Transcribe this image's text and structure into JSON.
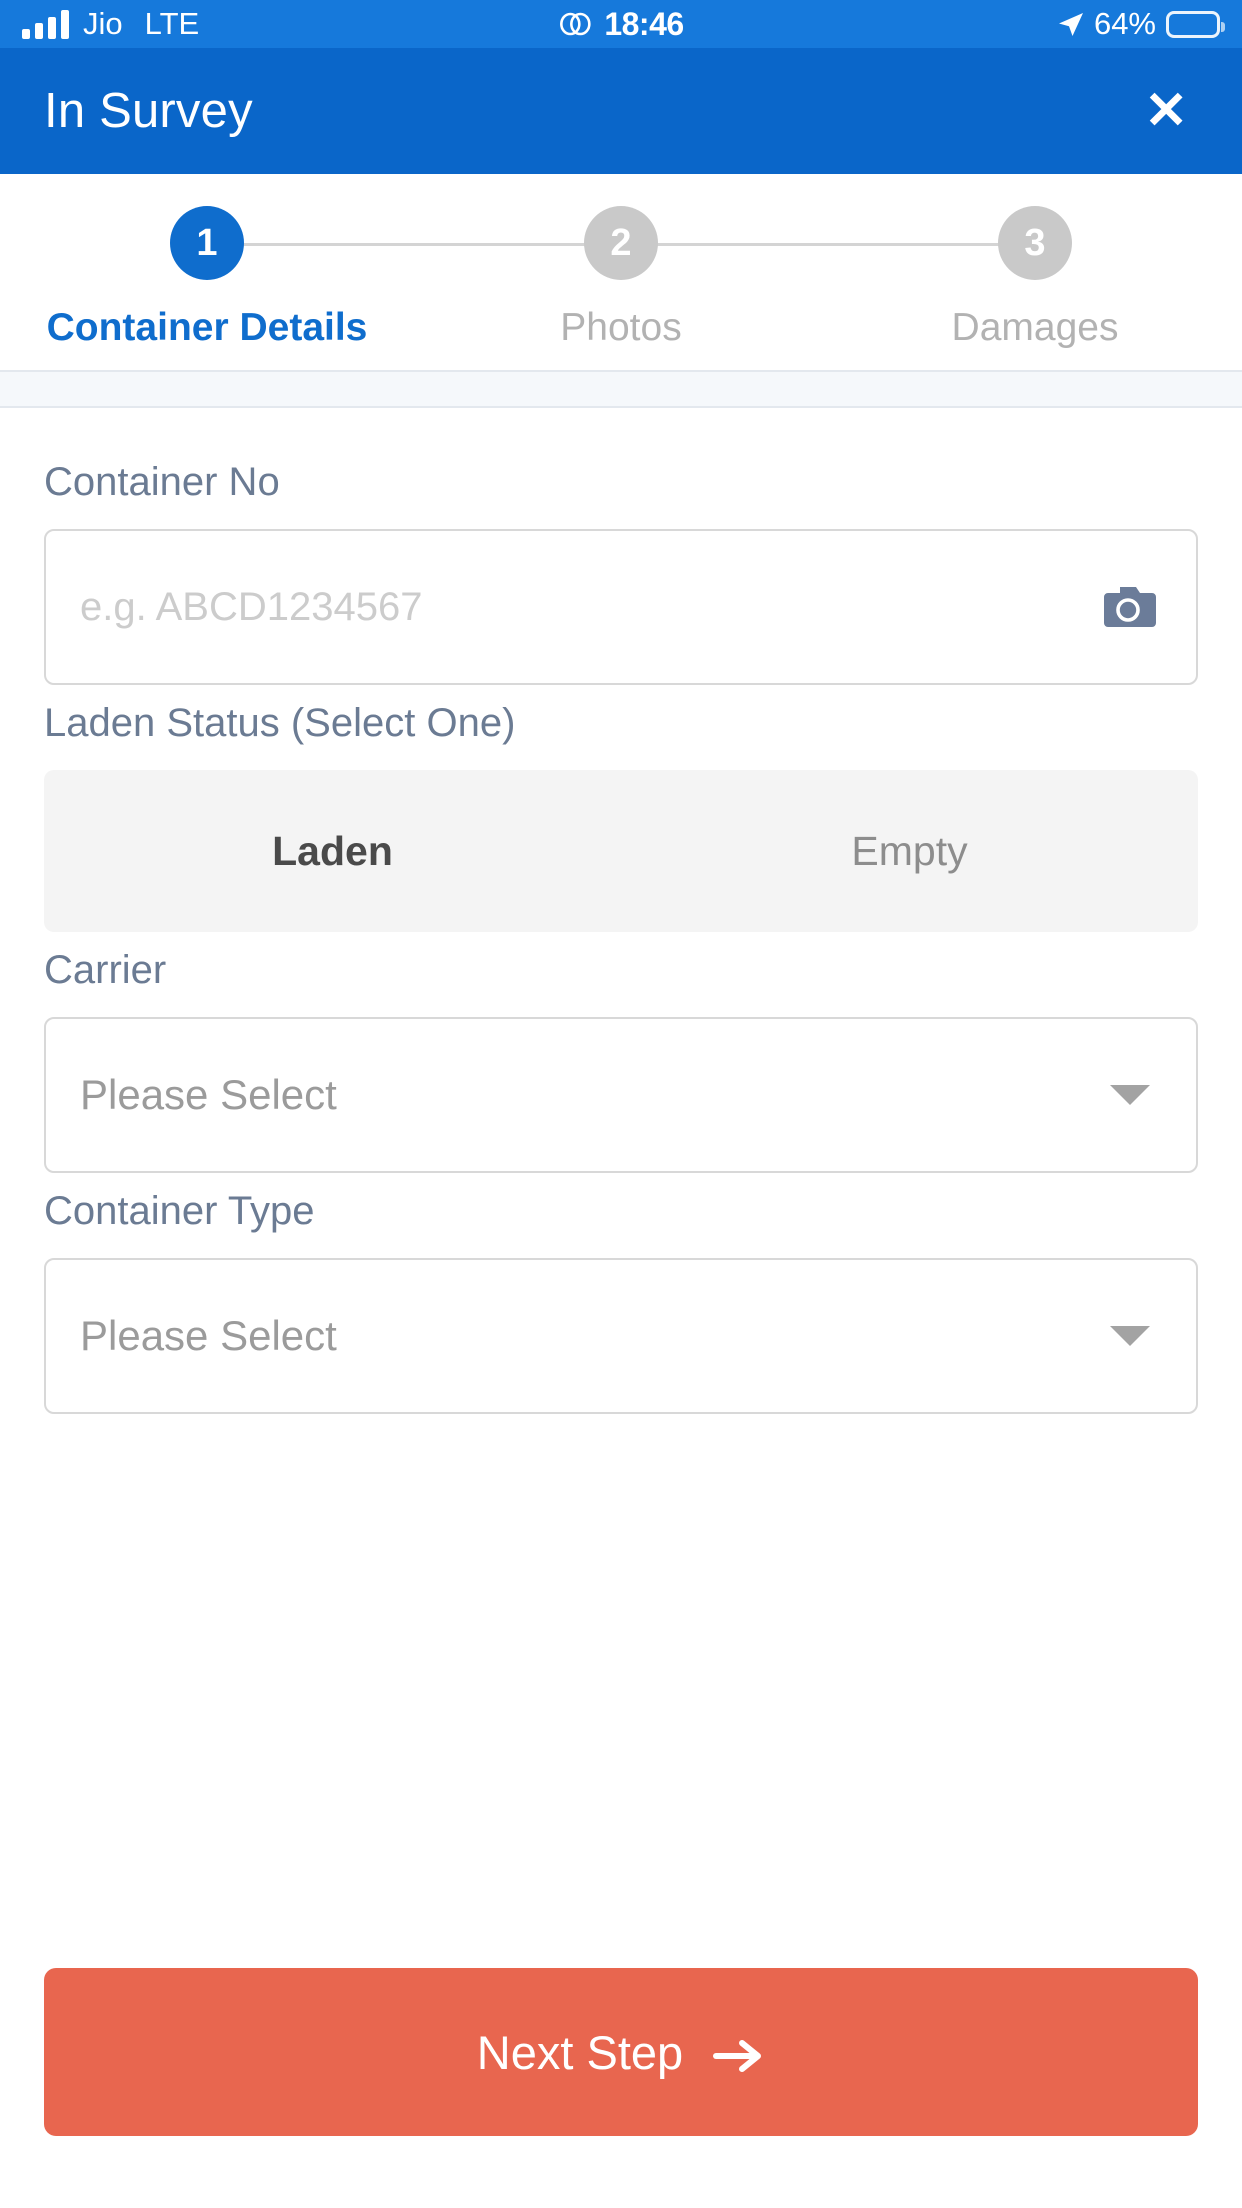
{
  "status_bar": {
    "carrier": "Jio",
    "network": "LTE",
    "time": "18:46",
    "battery_percent": "64%",
    "battery_level": 64,
    "signal_bars": 4,
    "link_icon": "link-icon",
    "location_icon": "location-arrow-icon",
    "battery_icon": "battery-icon",
    "background_color": "#1679db"
  },
  "header": {
    "title": "In Survey",
    "close_label": "✕",
    "close_icon": "close-icon",
    "background_color": "#0a66c9"
  },
  "stepper": {
    "active_index": 0,
    "active_color": "#0f6dcd",
    "inactive_color": "#c9c9c9",
    "steps": [
      {
        "number": "1",
        "label": "Container Details"
      },
      {
        "number": "2",
        "label": "Photos"
      },
      {
        "number": "3",
        "label": "Damages"
      }
    ]
  },
  "form": {
    "container_no": {
      "label": "Container No",
      "placeholder": "e.g. ABCD1234567",
      "value": "",
      "camera_icon": "camera-icon",
      "camera_icon_color": "#6b7c99"
    },
    "laden_status": {
      "label": "Laden Status (Select One)",
      "selected": "Laden",
      "options": [
        "Laden",
        "Empty"
      ]
    },
    "carrier": {
      "label": "Carrier",
      "value": "Please Select",
      "caret_icon": "chevron-down-icon"
    },
    "container_type": {
      "label": "Container Type",
      "value": "Please Select",
      "caret_icon": "chevron-down-icon"
    }
  },
  "footer": {
    "next_label": "Next Step",
    "next_icon": "arrow-right-icon",
    "next_color": "#e8664f"
  }
}
